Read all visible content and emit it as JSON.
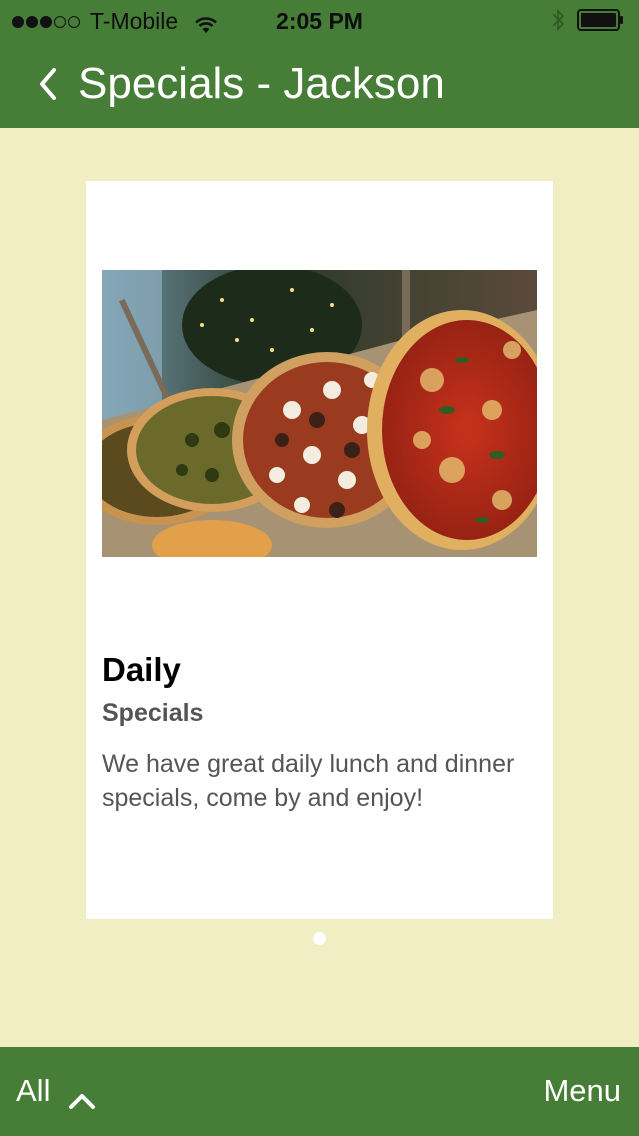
{
  "status_bar": {
    "carrier": "T-Mobile",
    "time": "2:05 PM",
    "signal_bars_filled": 3,
    "signal_bars_total": 5,
    "icons": [
      "wifi-icon",
      "bluetooth-icon",
      "battery-icon"
    ]
  },
  "nav": {
    "title": "Specials - Jackson",
    "back_icon": "chevron-left-icon"
  },
  "card": {
    "image_alt": "pizzas",
    "title": "Daily",
    "subtitle": "Specials",
    "description": "We have great daily lunch and dinner specials, come by and enjoy!"
  },
  "pager": {
    "current": 1,
    "total": 1
  },
  "toolbar": {
    "all_label": "All",
    "menu_label": "Menu",
    "all_icon": "chevron-up-icon"
  },
  "colors": {
    "bar_green": "#467e38",
    "background": "#f2eec4",
    "card": "#ffffff",
    "text_gray": "#555555"
  }
}
